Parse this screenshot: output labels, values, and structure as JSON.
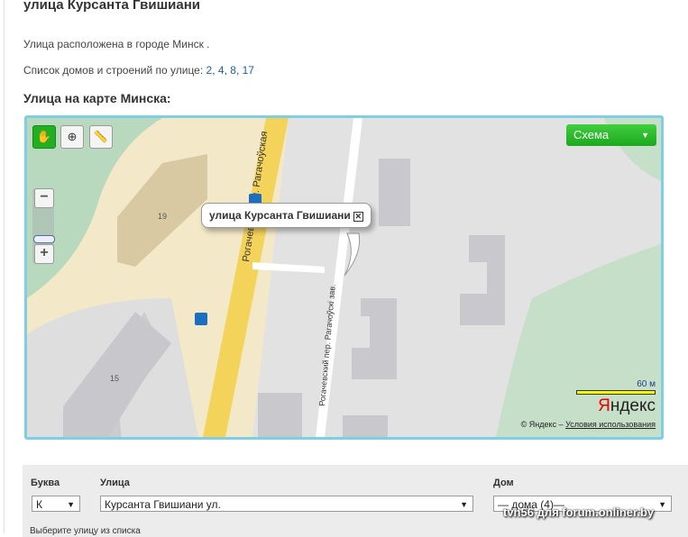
{
  "title": "улица Курсанта Гвишиани",
  "location_text": "Улица расположена в городе Минск .",
  "houses_label": "Список домов и строений по улице:",
  "houses": [
    "2",
    "4",
    "8",
    "17"
  ],
  "map_heading": "Улица на карте Минска:",
  "map": {
    "layer_button": "Схема",
    "balloon_text": "улица Курсанта Гвишиани",
    "building_labels": [
      "19",
      "15"
    ],
    "street_labels": [
      "Рогачевская ул. Рагачоўская",
      "Рогачевский пер. Рагачоўскі зав."
    ],
    "scale": "60 м",
    "logo": "Яндекс",
    "copyright": "© Яндекс –",
    "terms_link": "Условия использования"
  },
  "form": {
    "letter_label": "Буква",
    "letter_value": "К",
    "street_label": "Улица",
    "street_value": "Курсанта Гвишиани ул.",
    "house_label": "Дом",
    "house_value": "— дома (4)—",
    "hint": "Выберите улицу из списка"
  },
  "watermark": "tvn56 для forum.onliner.by"
}
